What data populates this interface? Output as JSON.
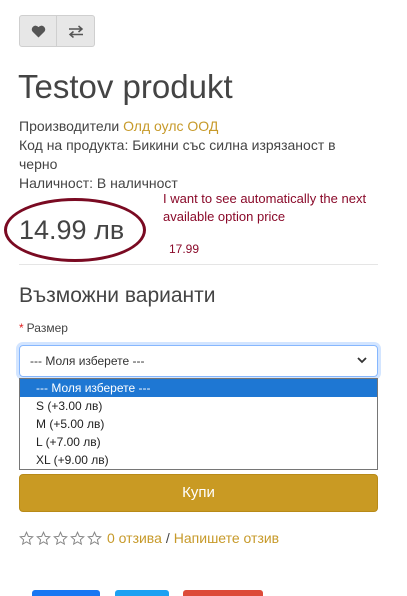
{
  "product": {
    "title": "Testov produkt",
    "manufacturer_label": "Производители",
    "manufacturer": "Олд оулс ООД",
    "code_label": "Код на продукта:",
    "code": "Бикини със силна изрязаност в черно",
    "availability_label": "Наличност:",
    "availability": "В наличност",
    "price": "14.99 лв"
  },
  "annotation": {
    "note": "I want to see automatically the next available option price",
    "price": "17.99",
    "circle_color": "#7a0a22"
  },
  "variants": {
    "title": "Възможни варианти",
    "required_mark": "*",
    "size_label": "Размер",
    "selected": "--- Моля изберете ---",
    "options": [
      "--- Моля изберете ---",
      "S (+3.00 лв)",
      "M (+5.00 лв)",
      "L (+7.00 лв)",
      "XL (+9.00 лв)"
    ]
  },
  "buy_label": "Купи",
  "reviews": {
    "count_link": "0 отзива",
    "separator": "/",
    "write_link": "Напишете отзив",
    "rating": 0
  },
  "icons": {
    "wishlist": "heart-icon",
    "compare": "exchange-icon",
    "star": "star-icon",
    "chevron": "chevron-down-icon"
  },
  "colors": {
    "accent": "#c99a23",
    "link": "#c79a2a",
    "selected_option": "#1e77d3",
    "facebook": "#1877f2",
    "twitter": "#1da1f2",
    "google": "#dd4b39"
  }
}
